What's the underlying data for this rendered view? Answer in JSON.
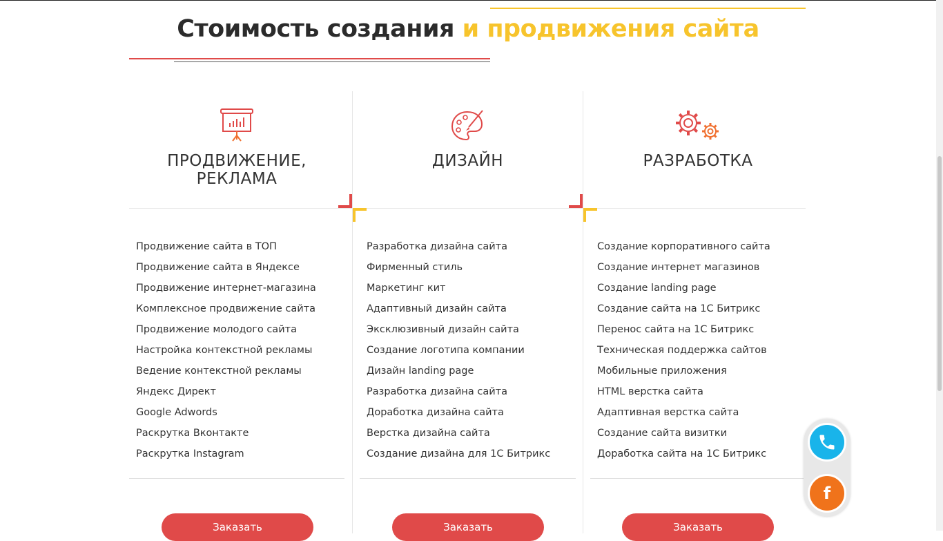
{
  "page": {
    "title_main": "Стоимость создания",
    "title_accent": "и продвижения сайта"
  },
  "colors": {
    "accent_red": "#e04a49",
    "accent_yellow": "#f7c42c",
    "phone_button": "#19b4ea",
    "facebook_button": "#f0731b",
    "text": "#333333"
  },
  "columns": [
    {
      "icon": "presentation-board-icon",
      "heading_line1": "ПРОДВИЖЕНИЕ,",
      "heading_line2": "РЕКЛАМА",
      "items": [
        "Продвижение сайта в ТОП",
        "Продвижение сайта в Яндексе",
        "Продвижение интернет-магазина",
        "Комплексное продвижение сайта",
        "Продвижение молодого сайта",
        "Настройка контекстной рекламы",
        "Ведение контекстной рекламы",
        "Яндекс Директ",
        "Google Adwords",
        "Раскрутка Вконтакте",
        "Раскрутка Instagram"
      ],
      "button_label": "Заказать"
    },
    {
      "icon": "palette-brush-icon",
      "heading_line1": "ДИЗАЙН",
      "heading_line2": "",
      "items": [
        "Разработка дизайна сайта",
        "Фирменный стиль",
        "Маркетинг кит",
        "Адаптивный дизайн сайта",
        "Эксклюзивный дизайн сайта",
        "Создание логотипа компании",
        "Дизайн landing page",
        "Разработка дизайна сайта",
        "Доработка дизайна сайта",
        "Верстка дизайна сайта",
        "Создание дизайна для 1С Битрикс"
      ],
      "button_label": "Заказать"
    },
    {
      "icon": "gears-icon",
      "heading_line1": "РАЗРАБОТКА",
      "heading_line2": "",
      "items": [
        "Создание корпоративного сайта",
        "Создание интернет магазинов",
        "Создание landing page",
        "Создание сайта на 1С Битрикс",
        "Перенос сайта на 1С Битрикс",
        "Техническая поддержка сайтов",
        "Мобильные приложения",
        "HTML верстка сайта",
        "Адаптивная верстка сайта",
        "Создание сайта визитки",
        "Доработка сайта на 1С Битрикс"
      ],
      "button_label": "Заказать"
    }
  ],
  "floating_widget": {
    "phone_icon": "phone-icon",
    "facebook_icon": "facebook-icon",
    "facebook_letter": "f"
  }
}
